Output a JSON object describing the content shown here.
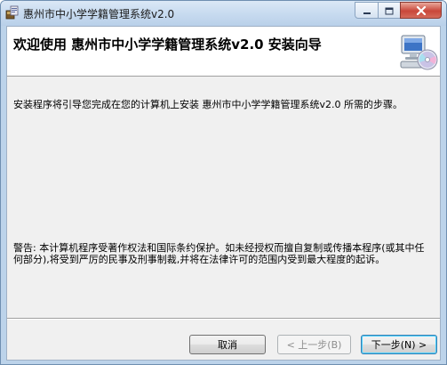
{
  "window": {
    "title": "惠州市中小学学籍管理系统v2.0",
    "icon": "installer-app-icon"
  },
  "caption_buttons": {
    "minimize": "minimize-icon",
    "maximize": "maximize-icon",
    "close": "close-icon"
  },
  "banner": {
    "title": "欢迎使用 惠州市中小学学籍管理系统v2.0 安装向导",
    "icon": "computer-cd-icon"
  },
  "body": {
    "intro": "安装程序将引导您完成在您的计算机上安装 惠州市中小学学籍管理系统v2.0 所需的步骤。",
    "warning": "警告: 本计算机程序受著作权法和国际条约保护。如未经授权而擅自复制或传播本程序(或其中任何部分),将受到严厉的民事及刑事制裁,并将在法律许可的范围内受到最大程度的起诉。"
  },
  "buttons": {
    "cancel": "取消",
    "prev": "< 上一步(B)",
    "next": "下一步(N) >"
  },
  "colors": {
    "close_button": "#c9473a",
    "titlebar": "#c6daef",
    "client_bg": "#f0f0f0"
  }
}
